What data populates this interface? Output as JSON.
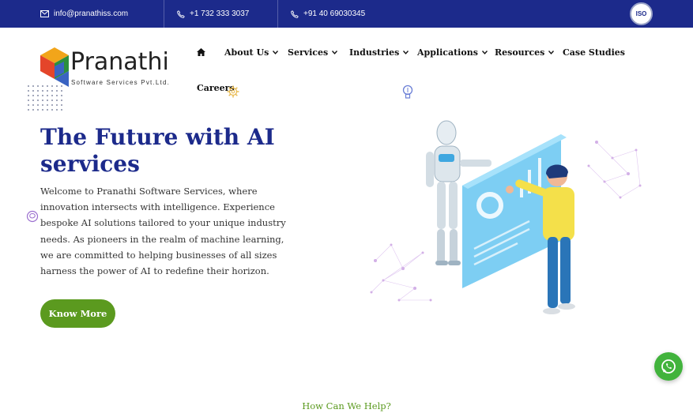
{
  "topbar": {
    "email": "info@pranathiss.com",
    "phone_us": "+1 732 333 3037",
    "phone_in": "+91 40 69030345",
    "iso_label": "ISO"
  },
  "logo": {
    "name": "Pranathi",
    "tagline": "Software Services Pvt.Ltd."
  },
  "nav": {
    "items": [
      {
        "label": "About Us"
      },
      {
        "label": "Services"
      },
      {
        "label": "Industries"
      },
      {
        "label": "Applications"
      },
      {
        "label": "Resources"
      },
      {
        "label": "Case Studies"
      },
      {
        "label": "Careers"
      }
    ]
  },
  "hero": {
    "title": "The Future with AI services",
    "description": "Welcome to Pranathi Software Services, where innovation intersects with intelligence. Experience bespoke AI solutions tailored to your unique industry needs. As pioneers in the realm of machine learning, we are committed to helping businesses of all sizes harness the power of AI to redefine their horizon.",
    "button_label": "Know More"
  },
  "section": {
    "help_label": "How Can We Help?"
  },
  "colors": {
    "brand_blue": "#1c2a8b",
    "brand_green": "#5b9a1f",
    "whatsapp_green": "#41b33c"
  },
  "icons": [
    "mail-icon",
    "phone-icon",
    "home-icon",
    "chevron-down-icon",
    "whatsapp-icon",
    "iso-badge-icon"
  ]
}
